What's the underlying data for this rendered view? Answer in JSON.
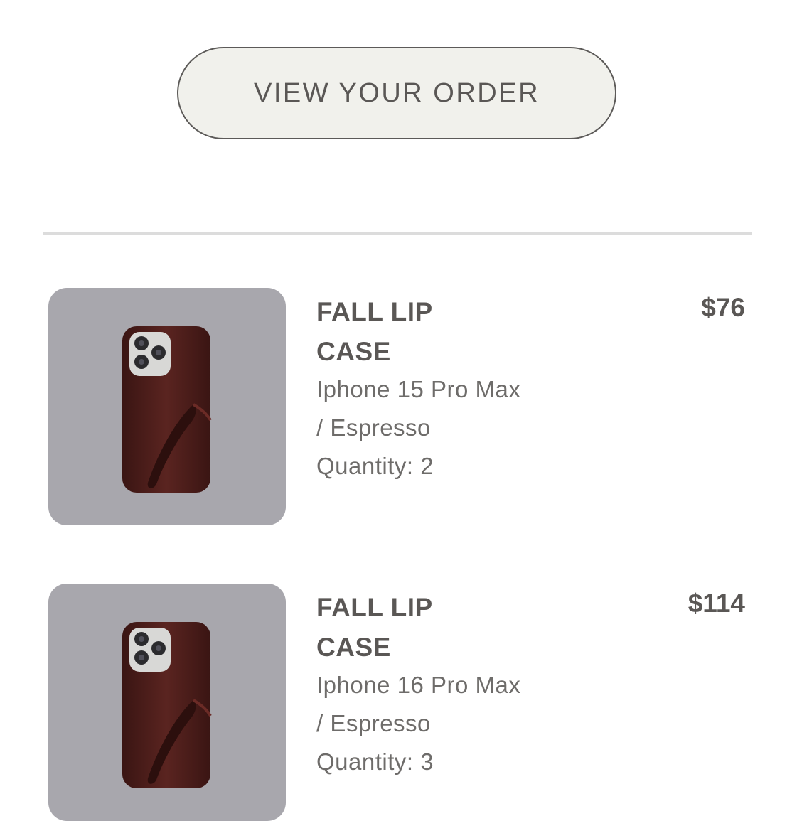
{
  "actions": {
    "view_order_label": "VIEW YOUR ORDER"
  },
  "order_items": [
    {
      "title": "FALL LIP CASE",
      "variant": "Iphone 15 Pro Max / Espresso",
      "quantity": "Quantity: 2",
      "price": "$76",
      "thumbnail_icon": "espresso-phone-case-image"
    },
    {
      "title": "FALL LIP CASE",
      "variant": "Iphone 16 Pro Max / Espresso",
      "quantity": "Quantity: 3",
      "price": "$114",
      "thumbnail_icon": "espresso-phone-case-image"
    }
  ],
  "colors": {
    "button_bg": "#f1f1ec",
    "thumb_bg": "#a8a7ad",
    "case_color": "#4a1d1a",
    "text_dark": "#5a5755",
    "text_muted": "#6e6c6a"
  }
}
